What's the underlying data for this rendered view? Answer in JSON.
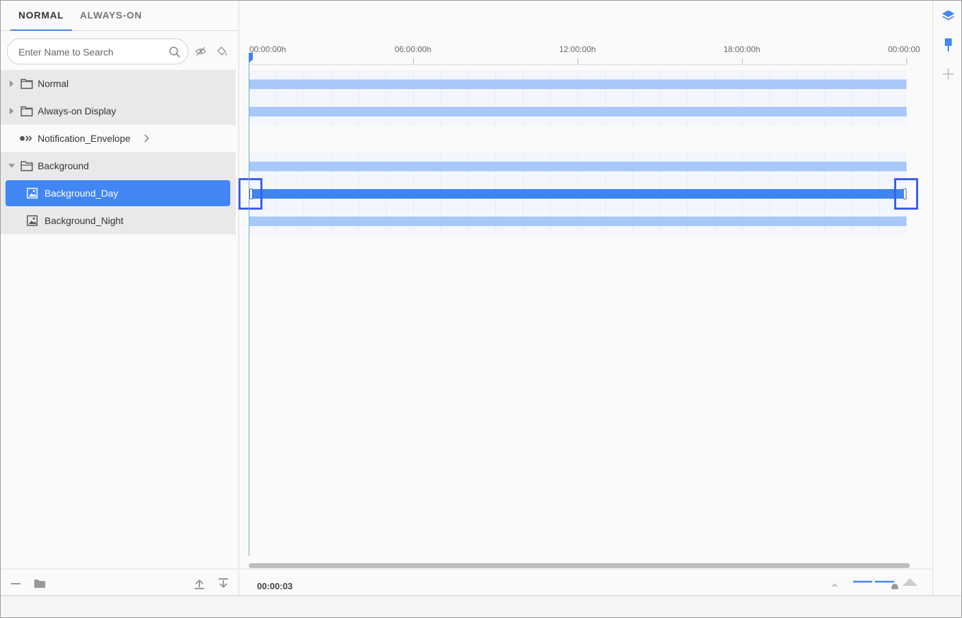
{
  "tabs": [
    {
      "label": "NORMAL",
      "active": true
    },
    {
      "label": "ALWAYS-ON",
      "active": false
    }
  ],
  "search": {
    "placeholder": "Enter Name to Search"
  },
  "tree": {
    "items": [
      {
        "label": "Normal",
        "type": "folder",
        "expanded": false
      },
      {
        "label": "Always-on Display",
        "type": "folder",
        "expanded": false
      },
      {
        "label": "Notification_Envelope",
        "type": "group",
        "expanded": false
      },
      {
        "label": "Background",
        "type": "folder",
        "expanded": true
      },
      {
        "label": "Background_Day",
        "type": "image",
        "selected": true
      },
      {
        "label": "Background_Night",
        "type": "image",
        "selected": false
      }
    ]
  },
  "ruler": {
    "labels": [
      "00:00:00h",
      "06:00:00h",
      "12:00:00h",
      "18:00:00h",
      "00:00:00"
    ]
  },
  "timeline": {
    "current_time": "00:00:03"
  },
  "colors": {
    "accent": "#4285f4",
    "bar": "#a8c8fa",
    "bar_active": "#3d86f0",
    "handle": "#3a5ee8",
    "playhead": "#5ab3c2"
  },
  "icons": {
    "search": "search-icon",
    "hide": "eye-off-icon",
    "fill": "paint-bucket-icon",
    "collapse": "minus-icon",
    "new_folder": "folder-icon",
    "move_up": "move-top-icon",
    "move_down": "move-bottom-icon",
    "layers": "layers-icon",
    "pin": "pin-icon",
    "add": "plus-icon"
  }
}
